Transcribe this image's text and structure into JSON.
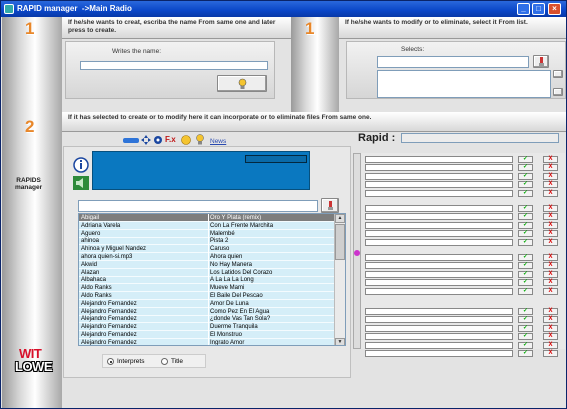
{
  "window": {
    "title": "RAPID manager  ->Main Radio",
    "minimize_glyph": "_",
    "maximize_glyph": "□",
    "close_glyph": "×"
  },
  "steps": {
    "create_step": "1",
    "modify_step": "1",
    "files_step": "2"
  },
  "create_panel": {
    "instruction": "If he/she wants to creat, escriba the name From same one and later press to create.",
    "name_label": "Writes the name:",
    "name_value": "",
    "create_button_icon": "lightbulb-icon"
  },
  "modify_panel": {
    "instruction": "If he/she wants to modify or to eliminate, select it From list.",
    "selects_label": "Selects:",
    "select_value": ""
  },
  "files_band": {
    "instruction": "If it has selected to create or to modify here it can incorporate or to eliminate files From same one."
  },
  "toolbar": {
    "news_label": "News",
    "fx_label": "F.x"
  },
  "side": {
    "rapids_line1": "RAPIDS",
    "rapids_line2": "manager",
    "logo_top": "WIT",
    "logo_bottom": "LOWE"
  },
  "rapid_header": {
    "label": "Rapid  :",
    "value": ""
  },
  "song_list": {
    "search_value": "",
    "rows": [
      {
        "artist": "Abigail",
        "title": "Oro Y Plata (remix)",
        "selected": true
      },
      {
        "artist": "Adriana Varela",
        "title": "Con La Frente Marchita"
      },
      {
        "artist": "Aguero",
        "title": "Malembé"
      },
      {
        "artist": "ahinoa",
        "title": "Pista 2"
      },
      {
        "artist": "Ahinoa y Miguel Nandez",
        "title": "Caruso"
      },
      {
        "artist": "ahora quien-si.mp3",
        "title": "Ahora quien"
      },
      {
        "artist": "Akwid",
        "title": "No Hay Manera"
      },
      {
        "artist": "Alazan",
        "title": "Los Latidos Del Corazo"
      },
      {
        "artist": "Albahaca",
        "title": "A La La La Long"
      },
      {
        "artist": "Aldo Ranks",
        "title": "Mueve Mami"
      },
      {
        "artist": "Aldo Ranks",
        "title": "El Baile Del Pescao"
      },
      {
        "artist": "Alejandro Fernandez",
        "title": "Amor De Luna"
      },
      {
        "artist": "Alejandro Fernandez",
        "title": "Como Pez En El Agua"
      },
      {
        "artist": "Alejandro Fernandez",
        "title": "¿donde Vas Tan Sola?"
      },
      {
        "artist": "Alejandro Fernandez",
        "title": "Duerme Tranquila"
      },
      {
        "artist": "Alejandro Fernandez",
        "title": "El Monstruo"
      },
      {
        "artist": "Alejandro Fernandez",
        "title": "Ingrato Amor"
      }
    ]
  },
  "search_mode": {
    "option_interprets": "Interprets",
    "option_title": "Title",
    "selected": "Interprets"
  },
  "right_list": {
    "ok_glyph": "✓",
    "delete_glyph": "X",
    "rows": 21
  },
  "colors": {
    "title_bar": "#0a46c8",
    "step_number": "#e8872a",
    "info_panel_blue": "#0a78c0",
    "list_background": "#d5eef8",
    "logo_red": "#d8102a"
  }
}
